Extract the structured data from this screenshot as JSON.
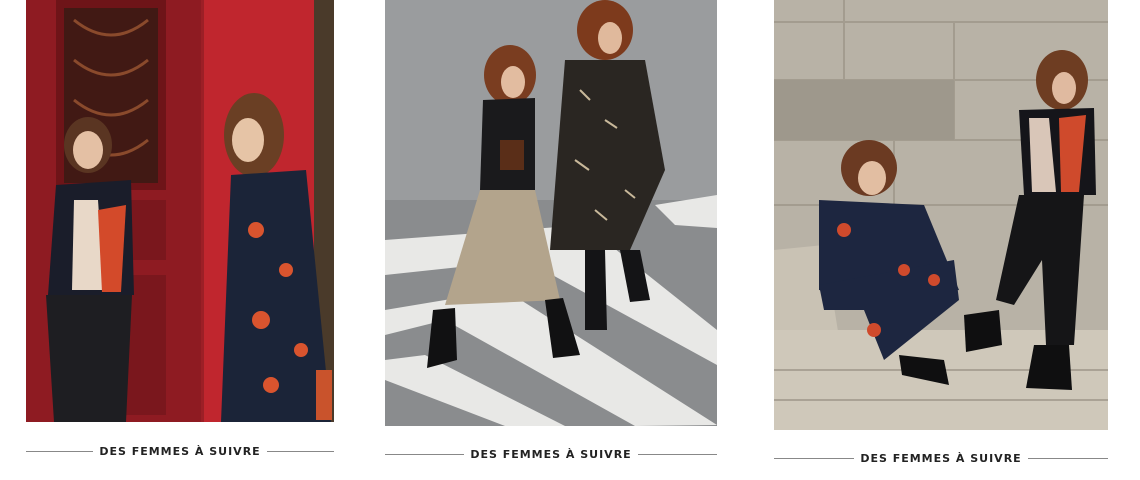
{
  "cards": [
    {
      "caption": "DES FEMMES À SUIVRE",
      "image_alt": "Two women posing in front of a red ornate door"
    },
    {
      "caption": "DES FEMMES À SUIVRE",
      "image_alt": "Two women walking across a pedestrian crossing"
    },
    {
      "caption": "DES FEMMES À SUIVRE",
      "image_alt": "Two women sitting and leaning on stone steps"
    }
  ],
  "colors": {
    "door_red": "#b3242b",
    "caption_text": "#222222",
    "caption_rule": "#888888"
  }
}
